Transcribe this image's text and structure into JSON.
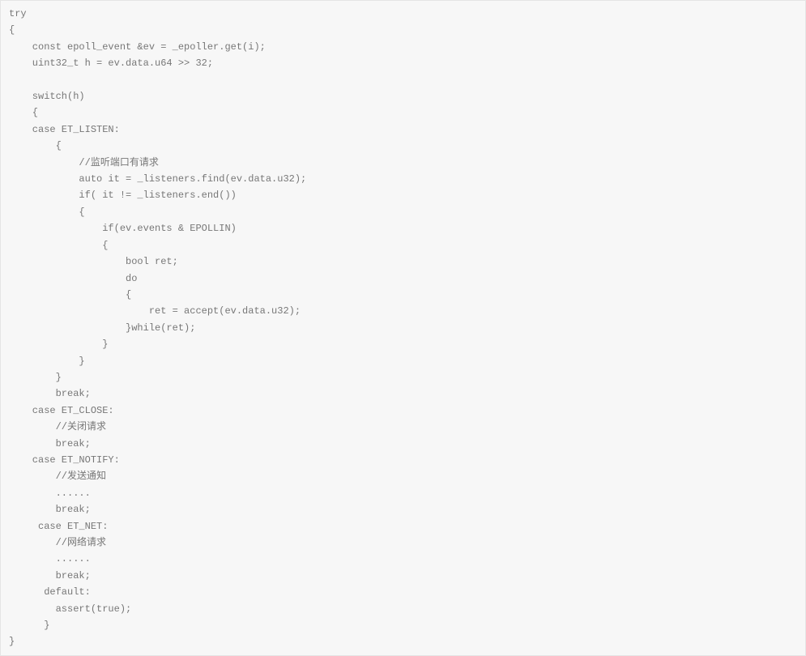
{
  "code": {
    "lines": [
      "try",
      "{",
      "    const epoll_event &ev = _epoller.get(i);",
      "    uint32_t h = ev.data.u64 >> 32;",
      "",
      "    switch(h)",
      "    {",
      "    case ET_LISTEN:",
      "        {",
      "            //监听端口有请求",
      "            auto it = _listeners.find(ev.data.u32);",
      "            if( it != _listeners.end())",
      "            {",
      "                if(ev.events & EPOLLIN)",
      "                {",
      "                    bool ret;",
      "                    do",
      "                    {",
      "                        ret = accept(ev.data.u32);",
      "                    }while(ret);",
      "                }",
      "            }",
      "        }",
      "        break;",
      "    case ET_CLOSE:",
      "        //关闭请求",
      "        break;",
      "    case ET_NOTIFY:",
      "        //发送通知",
      "        ......",
      "        break;",
      "     case ET_NET:",
      "        //网络请求",
      "        ......",
      "        break;",
      "      default:",
      "        assert(true);",
      "      }",
      "}"
    ]
  }
}
